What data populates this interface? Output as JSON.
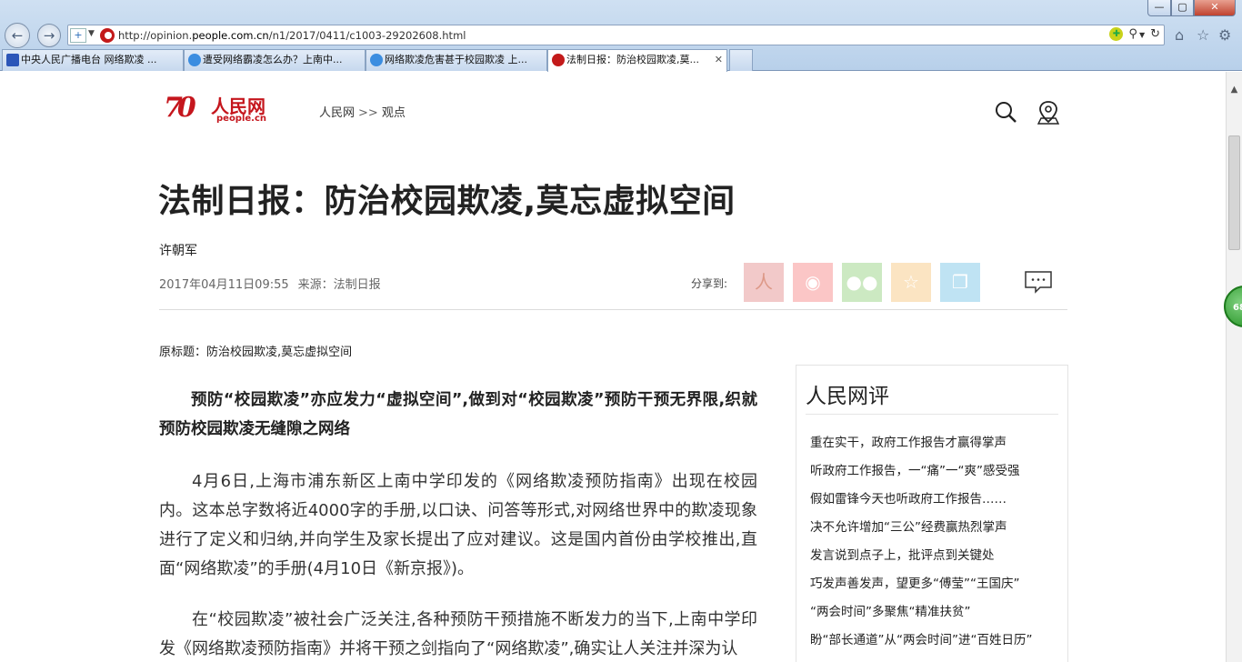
{
  "browser": {
    "window_controls": {
      "minimize": "—",
      "maximize": "▢",
      "close": "✕"
    },
    "url_prefix": "http://opinion.",
    "url_host": "people.com.cn",
    "url_path": "/n1/2017/0411/c1003-29202608.html",
    "tabs": [
      {
        "title": "中央人民广播电台 网络欺凌 ...",
        "active": false
      },
      {
        "title": "遭受网络霸凌怎么办？上南中...",
        "active": false
      },
      {
        "title": "网络欺凌危害甚于校园欺凌 上...",
        "active": false
      },
      {
        "title": "法制日报：防治校园欺凌,莫...",
        "active": true
      }
    ],
    "zoom_badge": "68"
  },
  "header": {
    "logo_number": "70",
    "logo_cn": "人民网",
    "logo_en": "people.cn",
    "breadcrumb": {
      "home": "人民网",
      "separator": ">>",
      "section": "观点"
    }
  },
  "article": {
    "title": "法制日报：防治校园欺凌,莫忘虚拟空间",
    "author": "许朝军",
    "datetime": "2017年04月11日09:55",
    "source": "来源：法制日报",
    "share_label": "分享到:",
    "original_title": "原标题：防治校园欺凌,莫忘虚拟空间",
    "paragraphs": [
      "预防“校园欺凌”亦应发力“虚拟空间”,做到对“校园欺凌”预防干预无界限,织就预防校园欺凌无缝隙之网络",
      "4月6日,上海市浦东新区上南中学印发的《网络欺凌预防指南》出现在校园内。这本总字数将近4000字的手册,以口诀、问答等形式,对网络世界中的欺凌现象进行了定义和归纳,并向学生及家长提出了应对建议。这是国内首份由学校推出,直面“网络欺凌”的手册(4月10日《新京报》)。",
      "在“校园欺凌”被社会广泛关注,各种预防干预措施不断发力的当下,上南中学印发《网络欺凌预防指南》并将干预之剑指向了“网络欺凌”,确实让人关注并深为认"
    ]
  },
  "sidebar": {
    "heading": "人民网评",
    "items": [
      "重在实干，政府工作报告才赢得掌声",
      "听政府工作报告，一“痛”一“爽”感受强",
      "假如雷锋今天也听政府工作报告……",
      "决不允许增加“三公”经费赢热烈掌声",
      "发言说到点子上，批评点到关键处",
      "巧发声善发声，望更多“傅莹”“王国庆”",
      "“两会时间”多聚焦“精准扶贫”",
      "盼“部长通道”从“两会时间”进“百姓日历”"
    ]
  }
}
